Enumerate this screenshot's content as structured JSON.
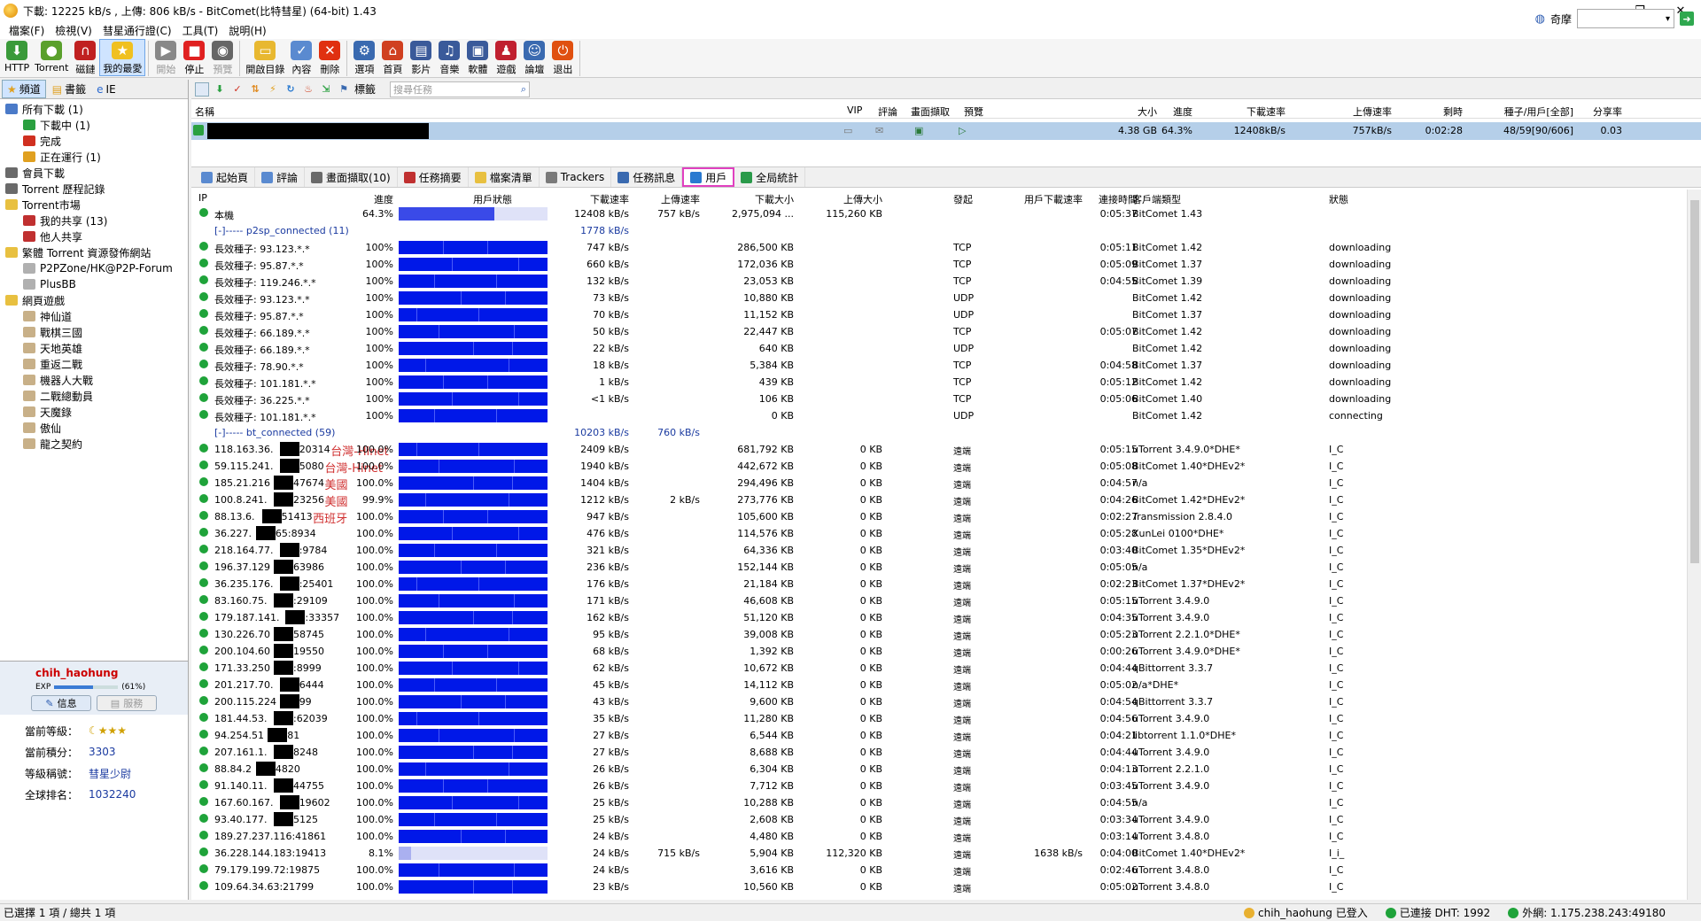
{
  "title": "下載: 12225 kB/s , 上傳: 806 kB/s - BitComet(比特彗星) (64-bit) 1.43",
  "menu": [
    "檔案(F)",
    "檢視(V)",
    "彗星通行證(C)",
    "工具(T)",
    "說明(H)"
  ],
  "toolbar": [
    {
      "label": "HTTP",
      "icon": "http-download-icon",
      "color": "#3a9a3a",
      "glyph": "⬇"
    },
    {
      "label": "Torrent",
      "icon": "torrent-icon",
      "color": "#5aa02c",
      "glyph": "●"
    },
    {
      "label": "磁鏈",
      "icon": "magnet-icon",
      "color": "#c02020",
      "glyph": "∩"
    },
    {
      "label": "我的最愛",
      "icon": "favorites-star-icon",
      "color": "#f0c020",
      "glyph": "★",
      "active": true
    },
    {
      "label": "開始",
      "icon": "start-icon",
      "color": "#888888",
      "glyph": "▶",
      "disabled": true
    },
    {
      "label": "停止",
      "icon": "stop-icon",
      "color": "#e02020",
      "glyph": "■"
    },
    {
      "label": "預覽",
      "icon": "preview-icon",
      "color": "#666666",
      "glyph": "◉",
      "disabled": true
    },
    {
      "label": "開啟目錄",
      "icon": "open-folder-icon",
      "color": "#e8b830",
      "glyph": "▭"
    },
    {
      "label": "內容",
      "icon": "properties-icon",
      "color": "#5a8ad0",
      "glyph": "✓"
    },
    {
      "label": "刪除",
      "icon": "delete-icon",
      "color": "#e03010",
      "glyph": "✕"
    },
    {
      "label": "選項",
      "icon": "options-icon",
      "color": "#3a6ab0",
      "glyph": "⚙"
    },
    {
      "label": "首頁",
      "icon": "home-icon",
      "color": "#d04020",
      "glyph": "⌂"
    },
    {
      "label": "影片",
      "icon": "video-icon",
      "color": "#3a5a9a",
      "glyph": "▤"
    },
    {
      "label": "音樂",
      "icon": "music-icon",
      "color": "#3a5a9a",
      "glyph": "♫"
    },
    {
      "label": "軟體",
      "icon": "software-icon",
      "color": "#3a5a9a",
      "glyph": "▣"
    },
    {
      "label": "遊戲",
      "icon": "game-icon",
      "color": "#c02030",
      "glyph": "♟"
    },
    {
      "label": "論壇",
      "icon": "forum-icon",
      "color": "#3a6ab0",
      "glyph": "☺"
    },
    {
      "label": "退出",
      "icon": "exit-icon",
      "color": "#e05010",
      "glyph": "⏻"
    }
  ],
  "toolbar_right": {
    "label": "奇摩"
  },
  "left_tabs": [
    "頻道",
    "書籤",
    "IE"
  ],
  "tree": [
    {
      "label": "所有下載 (1)",
      "indent": 0,
      "color": "#4a7ac8"
    },
    {
      "label": "下載中 (1)",
      "indent": 1,
      "color": "#2aa040"
    },
    {
      "label": "完成",
      "indent": 1,
      "color": "#d03020"
    },
    {
      "label": "正在運行 (1)",
      "indent": 1,
      "color": "#e0a020"
    },
    {
      "label": "會員下載",
      "indent": 0,
      "color": "#6a6a6a"
    },
    {
      "label": "Torrent 歷程記錄",
      "indent": 0,
      "color": "#6a6a6a"
    },
    {
      "label": "Torrent市場",
      "indent": 0,
      "color": "#e8c040"
    },
    {
      "label": "我的共享 (13)",
      "indent": 1,
      "color": "#c03030"
    },
    {
      "label": "他人共享",
      "indent": 1,
      "color": "#c03030"
    },
    {
      "label": "繁體 Torrent 資源發佈網站",
      "indent": 0,
      "color": "#e8c040"
    },
    {
      "label": "P2PZone/HK@P2P-Forum",
      "indent": 1,
      "color": "#b0b0b0"
    },
    {
      "label": "PlusBB",
      "indent": 1,
      "color": "#b0b0b0"
    },
    {
      "label": "網頁遊戲",
      "indent": 0,
      "color": "#e8c040"
    },
    {
      "label": "神仙道",
      "indent": 1,
      "color": "#c8b088"
    },
    {
      "label": "戰棋三國",
      "indent": 1,
      "color": "#c8b088"
    },
    {
      "label": "天地英雄",
      "indent": 1,
      "color": "#c8b088"
    },
    {
      "label": "重返二戰",
      "indent": 1,
      "color": "#c8b088"
    },
    {
      "label": "機器人大戰",
      "indent": 1,
      "color": "#c8b088"
    },
    {
      "label": "二戰總動員",
      "indent": 1,
      "color": "#c8b088"
    },
    {
      "label": "天魔錄",
      "indent": 1,
      "color": "#c8b088"
    },
    {
      "label": "傲仙",
      "indent": 1,
      "color": "#c8b088"
    },
    {
      "label": "龍之契約",
      "indent": 1,
      "color": "#c8b088"
    }
  ],
  "user": {
    "name": "chih_haohung",
    "exp_label": "EXP",
    "exp_percent": "(61%)",
    "exp_fraction": 0.61,
    "btn_info": "信息",
    "btn_service": "服務",
    "rows": [
      {
        "k": "當前等級：",
        "v": "☾★★★"
      },
      {
        "k": "當前積分：",
        "v": "3303"
      },
      {
        "k": "等級稱號：",
        "v": "彗星少尉"
      },
      {
        "k": "全球排名：",
        "v": "1032240"
      }
    ]
  },
  "task_toolbar": {
    "tag_label": "標籤",
    "search_placeholder": "搜尋任務"
  },
  "task_headers": [
    "名稱",
    "VIP",
    "評論",
    "畫面擷取",
    "預覽",
    "大小",
    "進度",
    "下載速率",
    "上傳速率",
    "剩時",
    "種子/用戶[全部]",
    "分享率"
  ],
  "task": {
    "size": "4.38 GB",
    "progress": "64.3%",
    "down": "12408kB/s",
    "up": "757kB/s",
    "eta": "0:02:28",
    "seeds": "48/59[90/606]",
    "ratio": "0.03"
  },
  "bottom_tabs": [
    {
      "label": "起始頁",
      "color": "#5a8ad0"
    },
    {
      "label": "評論",
      "color": "#5a8ad0"
    },
    {
      "label": "畫面擷取(10)",
      "color": "#6a6a6a"
    },
    {
      "label": "任務摘要",
      "color": "#c03030"
    },
    {
      "label": "檔案清單",
      "color": "#e8c040"
    },
    {
      "label": "Trackers",
      "color": "#7a7a7a"
    },
    {
      "label": "任務訊息",
      "color": "#3a6ab0"
    },
    {
      "label": "用戶",
      "color": "#2a7ad0",
      "selected": true
    },
    {
      "label": "全局統計",
      "color": "#2a9a4a"
    }
  ],
  "peer_headers": [
    "IP",
    "進度",
    "用戶狀態",
    "下載速率",
    "上傳速率",
    "下載大小",
    "上傳大小",
    "發起",
    "用戶下載速率",
    "連接時間",
    "客戶端類型",
    "狀態"
  ],
  "peers": [
    {
      "kind": "peer",
      "ip": "本機",
      "progress": "64.3%",
      "pct": 64.3,
      "down": "12408 kB/s",
      "up": "757 kB/s",
      "dsize": "2,975,094 ...",
      "usize": "115,260 KB",
      "init": "",
      "udown": "",
      "time": "0:05:37",
      "client": "BitComet 1.43",
      "state": "",
      "partial": true
    },
    {
      "kind": "group",
      "label": "[-]----- p2sp_connected (11)",
      "down": "1778 kB/s",
      "up": ""
    },
    {
      "kind": "peer",
      "ip": "長效種子: 93.123.*.*",
      "progress": "100%",
      "pct": 100,
      "down": "747 kB/s",
      "up": "",
      "dsize": "286,500 KB",
      "usize": "",
      "init": "TCP",
      "udown": "",
      "time": "0:05:11",
      "client": "BitComet 1.42",
      "state": "downloading"
    },
    {
      "kind": "peer",
      "ip": "長效種子: 95.87.*.*",
      "progress": "100%",
      "pct": 100,
      "down": "660 kB/s",
      "up": "",
      "dsize": "172,036 KB",
      "usize": "",
      "init": "TCP",
      "udown": "",
      "time": "0:05:09",
      "client": "BitComet 1.37",
      "state": "downloading"
    },
    {
      "kind": "peer",
      "ip": "長效種子: 119.246.*.*",
      "progress": "100%",
      "pct": 100,
      "down": "132 kB/s",
      "up": "",
      "dsize": "23,053 KB",
      "usize": "",
      "init": "TCP",
      "udown": "",
      "time": "0:04:55",
      "client": "BitComet 1.39",
      "state": "downloading"
    },
    {
      "kind": "peer",
      "ip": "長效種子: 93.123.*.*",
      "progress": "100%",
      "pct": 100,
      "down": "73 kB/s",
      "up": "",
      "dsize": "10,880 KB",
      "usize": "",
      "init": "UDP",
      "udown": "",
      "time": "",
      "client": "BitComet 1.42",
      "state": "downloading"
    },
    {
      "kind": "peer",
      "ip": "長效種子: 95.87.*.*",
      "progress": "100%",
      "pct": 100,
      "down": "70 kB/s",
      "up": "",
      "dsize": "11,152 KB",
      "usize": "",
      "init": "UDP",
      "udown": "",
      "time": "",
      "client": "BitComet 1.37",
      "state": "downloading"
    },
    {
      "kind": "peer",
      "ip": "長效種子: 66.189.*.*",
      "progress": "100%",
      "pct": 100,
      "down": "50 kB/s",
      "up": "",
      "dsize": "22,447 KB",
      "usize": "",
      "init": "TCP",
      "udown": "",
      "time": "0:05:07",
      "client": "BitComet 1.42",
      "state": "downloading"
    },
    {
      "kind": "peer",
      "ip": "長效種子: 66.189.*.*",
      "progress": "100%",
      "pct": 100,
      "down": "22 kB/s",
      "up": "",
      "dsize": "640 KB",
      "usize": "",
      "init": "UDP",
      "udown": "",
      "time": "",
      "client": "BitComet 1.42",
      "state": "downloading"
    },
    {
      "kind": "peer",
      "ip": "長效種子: 78.90.*.*",
      "progress": "100%",
      "pct": 100,
      "down": "18 kB/s",
      "up": "",
      "dsize": "5,384 KB",
      "usize": "",
      "init": "TCP",
      "udown": "",
      "time": "0:04:58",
      "client": "BitComet 1.37",
      "state": "downloading"
    },
    {
      "kind": "peer",
      "ip": "長效種子: 101.181.*.*",
      "progress": "100%",
      "pct": 100,
      "down": "1 kB/s",
      "up": "",
      "dsize": "439 KB",
      "usize": "",
      "init": "TCP",
      "udown": "",
      "time": "0:05:12",
      "client": "BitComet 1.42",
      "state": "downloading"
    },
    {
      "kind": "peer",
      "ip": "長效種子: 36.225.*.*",
      "progress": "100%",
      "pct": 100,
      "down": "<1 kB/s",
      "up": "",
      "dsize": "106 KB",
      "usize": "",
      "init": "TCP",
      "udown": "",
      "time": "0:05:06",
      "client": "BitComet 1.40",
      "state": "downloading"
    },
    {
      "kind": "peer",
      "ip": "長效種子: 101.181.*.*",
      "progress": "100%",
      "pct": 100,
      "down": "",
      "up": "",
      "dsize": "0 KB",
      "usize": "",
      "init": "UDP",
      "udown": "",
      "time": "",
      "client": "BitComet 1.42",
      "state": "connecting"
    },
    {
      "kind": "group",
      "label": "[-]----- bt_connected (59)",
      "down": "10203 kB/s",
      "up": "760 kB/s"
    },
    {
      "kind": "peer",
      "ip": "118.163.36.",
      "ip2": "20314",
      "loc": "台灣-Hinet",
      "progress": "100.0%",
      "pct": 100,
      "down": "2409 kB/s",
      "up": "",
      "dsize": "681,792 KB",
      "usize": "0 KB",
      "init": "遠端",
      "udown": "",
      "time": "0:05:15",
      "client": "uTorrent 3.4.9.0*DHE*",
      "state": "I_C"
    },
    {
      "kind": "peer",
      "ip": "59.115.241.",
      "ip2": "5080",
      "loc": "台灣-Hinet",
      "progress": "100.0%",
      "pct": 100,
      "down": "1940 kB/s",
      "up": "",
      "dsize": "442,672 KB",
      "usize": "0 KB",
      "init": "遠端",
      "udown": "",
      "time": "0:05:08",
      "client": "BitComet 1.40*DHEv2*",
      "state": "I_C"
    },
    {
      "kind": "peer",
      "ip": "185.21.216",
      "ip2": "47674",
      "loc": "美國",
      "progress": "100.0%",
      "pct": 100,
      "down": "1404 kB/s",
      "up": "",
      "dsize": "294,496 KB",
      "usize": "0 KB",
      "init": "遠端",
      "udown": "",
      "time": "0:04:57",
      "client": "n/a",
      "state": "I_C"
    },
    {
      "kind": "peer",
      "ip": "100.8.241.",
      "ip2": "23256",
      "loc": "美國",
      "progress": "99.9%",
      "pct": 99.9,
      "down": "1212 kB/s",
      "up": "2 kB/s",
      "dsize": "273,776 KB",
      "usize": "0 KB",
      "init": "遠端",
      "udown": "",
      "time": "0:04:26",
      "client": "BitComet 1.42*DHEv2*",
      "state": "I_C"
    },
    {
      "kind": "peer",
      "ip": "88.13.6.",
      "ip2": "51413",
      "loc": "西班牙",
      "progress": "100.0%",
      "pct": 100,
      "down": "947 kB/s",
      "up": "",
      "dsize": "105,600 KB",
      "usize": "0 KB",
      "init": "遠端",
      "udown": "",
      "time": "0:02:27",
      "client": "Transmission 2.8.4.0",
      "state": "I_C"
    },
    {
      "kind": "peer",
      "ip": "36.227.",
      "ip2": "65:8934",
      "progress": "100.0%",
      "pct": 100,
      "down": "476 kB/s",
      "up": "",
      "dsize": "114,576 KB",
      "usize": "0 KB",
      "init": "遠端",
      "udown": "",
      "time": "0:05:28",
      "client": "XunLei 0100*DHE*",
      "state": "I_C"
    },
    {
      "kind": "peer",
      "ip": "218.164.77.",
      "ip2": ":9784",
      "progress": "100.0%",
      "pct": 100,
      "down": "321 kB/s",
      "up": "",
      "dsize": "64,336 KB",
      "usize": "0 KB",
      "init": "遠端",
      "udown": "",
      "time": "0:03:40",
      "client": "BitComet 1.35*DHEv2*",
      "state": "I_C"
    },
    {
      "kind": "peer",
      "ip": "196.37.129",
      "ip2": "63986",
      "progress": "100.0%",
      "pct": 100,
      "down": "236 kB/s",
      "up": "",
      "dsize": "152,144 KB",
      "usize": "0 KB",
      "init": "遠端",
      "udown": "",
      "time": "0:05:05",
      "client": "n/a",
      "state": "I_C"
    },
    {
      "kind": "peer",
      "ip": "36.235.176.",
      "ip2": ":25401",
      "progress": "100.0%",
      "pct": 100,
      "down": "176 kB/s",
      "up": "",
      "dsize": "21,184 KB",
      "usize": "0 KB",
      "init": "遠端",
      "udown": "",
      "time": "0:02:23",
      "client": "BitComet 1.37*DHEv2*",
      "state": "I_C"
    },
    {
      "kind": "peer",
      "ip": "83.160.75.",
      "ip2": ":29109",
      "progress": "100.0%",
      "pct": 100,
      "down": "171 kB/s",
      "up": "",
      "dsize": "46,608 KB",
      "usize": "0 KB",
      "init": "遠端",
      "udown": "",
      "time": "0:05:15",
      "client": "uTorrent 3.4.9.0",
      "state": "I_C"
    },
    {
      "kind": "peer",
      "ip": "179.187.141.",
      "ip2": ":33357",
      "progress": "100.0%",
      "pct": 100,
      "down": "162 kB/s",
      "up": "",
      "dsize": "51,120 KB",
      "usize": "0 KB",
      "init": "遠端",
      "udown": "",
      "time": "0:04:35",
      "client": "uTorrent 3.4.9.0",
      "state": "I_C"
    },
    {
      "kind": "peer",
      "ip": "130.226.70",
      "ip2": "58745",
      "progress": "100.0%",
      "pct": 100,
      "down": "95 kB/s",
      "up": "",
      "dsize": "39,008 KB",
      "usize": "0 KB",
      "init": "遠端",
      "udown": "",
      "time": "0:05:23",
      "client": "uTorrent 2.2.1.0*DHE*",
      "state": "I_C"
    },
    {
      "kind": "peer",
      "ip": "200.104.60",
      "ip2": "19550",
      "progress": "100.0%",
      "pct": 100,
      "down": "68 kB/s",
      "up": "",
      "dsize": "1,392 KB",
      "usize": "0 KB",
      "init": "遠端",
      "udown": "",
      "time": "0:00:26",
      "client": "uTorrent 3.4.9.0*DHE*",
      "state": "I_C"
    },
    {
      "kind": "peer",
      "ip": "171.33.250",
      "ip2": ":8999",
      "progress": "100.0%",
      "pct": 100,
      "down": "62 kB/s",
      "up": "",
      "dsize": "10,672 KB",
      "usize": "0 KB",
      "init": "遠端",
      "udown": "",
      "time": "0:04:44",
      "client": "qBittorrent 3.3.7",
      "state": "I_C"
    },
    {
      "kind": "peer",
      "ip": "201.217.70.",
      "ip2": "6444",
      "progress": "100.0%",
      "pct": 100,
      "down": "45 kB/s",
      "up": "",
      "dsize": "14,112 KB",
      "usize": "0 KB",
      "init": "遠端",
      "udown": "",
      "time": "0:05:02",
      "client": "n/a*DHE*",
      "state": "I_C"
    },
    {
      "kind": "peer",
      "ip": "200.115.224",
      "ip2": "99",
      "progress": "100.0%",
      "pct": 100,
      "down": "43 kB/s",
      "up": "",
      "dsize": "9,600 KB",
      "usize": "0 KB",
      "init": "遠端",
      "udown": "",
      "time": "0:04:54",
      "client": "qBittorrent 3.3.7",
      "state": "I_C"
    },
    {
      "kind": "peer",
      "ip": "181.44.53.",
      "ip2": ":62039",
      "progress": "100.0%",
      "pct": 100,
      "down": "35 kB/s",
      "up": "",
      "dsize": "11,280 KB",
      "usize": "0 KB",
      "init": "遠端",
      "udown": "",
      "time": "0:04:56",
      "client": "uTorrent 3.4.9.0",
      "state": "I_C"
    },
    {
      "kind": "peer",
      "ip": "94.254.51",
      "ip2": "81",
      "progress": "100.0%",
      "pct": 100,
      "down": "27 kB/s",
      "up": "",
      "dsize": "6,544 KB",
      "usize": "0 KB",
      "init": "遠端",
      "udown": "",
      "time": "0:04:21",
      "client": "libtorrent 1.1.0*DHE*",
      "state": "I_C"
    },
    {
      "kind": "peer",
      "ip": "207.161.1.",
      "ip2": "8248",
      "progress": "100.0%",
      "pct": 100,
      "down": "27 kB/s",
      "up": "",
      "dsize": "8,688 KB",
      "usize": "0 KB",
      "init": "遠端",
      "udown": "",
      "time": "0:04:44",
      "client": "uTorrent 3.4.9.0",
      "state": "I_C"
    },
    {
      "kind": "peer",
      "ip": "88.84.2",
      "ip2": "4820",
      "progress": "100.0%",
      "pct": 100,
      "down": "26 kB/s",
      "up": "",
      "dsize": "6,304 KB",
      "usize": "0 KB",
      "init": "遠端",
      "udown": "",
      "time": "0:04:13",
      "client": "uTorrent 2.2.1.0",
      "state": "I_C"
    },
    {
      "kind": "peer",
      "ip": "91.140.11.",
      "ip2": "44755",
      "progress": "100.0%",
      "pct": 100,
      "down": "26 kB/s",
      "up": "",
      "dsize": "7,712 KB",
      "usize": "0 KB",
      "init": "遠端",
      "udown": "",
      "time": "0:03:45",
      "client": "uTorrent 3.4.9.0",
      "state": "I_C"
    },
    {
      "kind": "peer",
      "ip": "167.60.167.",
      "ip2": "19602",
      "progress": "100.0%",
      "pct": 100,
      "down": "25 kB/s",
      "up": "",
      "dsize": "10,288 KB",
      "usize": "0 KB",
      "init": "遠端",
      "udown": "",
      "time": "0:04:55",
      "client": "n/a",
      "state": "I_C"
    },
    {
      "kind": "peer",
      "ip": "93.40.177.",
      "ip2": "5125",
      "progress": "100.0%",
      "pct": 100,
      "down": "25 kB/s",
      "up": "",
      "dsize": "2,608 KB",
      "usize": "0 KB",
      "init": "遠端",
      "udown": "",
      "time": "0:03:34",
      "client": "uTorrent 3.4.9.0",
      "state": "I_C"
    },
    {
      "kind": "peer",
      "ip": "189.27.237.116:41861",
      "progress": "100.0%",
      "pct": 100,
      "down": "24 kB/s",
      "up": "",
      "dsize": "4,480 KB",
      "usize": "0 KB",
      "init": "遠端",
      "udown": "",
      "time": "0:03:14",
      "client": "uTorrent 3.4.8.0",
      "state": "I_C"
    },
    {
      "kind": "peer",
      "ip": "36.228.144.183:19413",
      "progress": "8.1%",
      "pct": 8.1,
      "down": "24 kB/s",
      "up": "715 kB/s",
      "dsize": "5,904 KB",
      "usize": "112,320 KB",
      "init": "遠端",
      "udown": "1638 kB/s",
      "time": "0:04:00",
      "client": "BitComet 1.40*DHEv2*",
      "state": "I_i_",
      "partial": true
    },
    {
      "kind": "peer",
      "ip": "79.179.199.72:19875",
      "progress": "100.0%",
      "pct": 100,
      "down": "24 kB/s",
      "up": "",
      "dsize": "3,616 KB",
      "usize": "0 KB",
      "init": "遠端",
      "udown": "",
      "time": "0:02:46",
      "client": "uTorrent 3.4.8.0",
      "state": "I_C"
    },
    {
      "kind": "peer",
      "ip": "109.64.34.63:21799",
      "progress": "100.0%",
      "pct": 100,
      "down": "23 kB/s",
      "up": "",
      "dsize": "10,560 KB",
      "usize": "0 KB",
      "init": "遠端",
      "udown": "",
      "time": "0:05:02",
      "client": "uTorrent 3.4.8.0",
      "state": "I_C"
    }
  ],
  "status": {
    "selection": "已選擇 1 項 / 總共 1 項",
    "login": "chih_haohung 已登入",
    "dht": "已連接 DHT: 1992",
    "external": "外網: 1.175.238.243:49180"
  }
}
